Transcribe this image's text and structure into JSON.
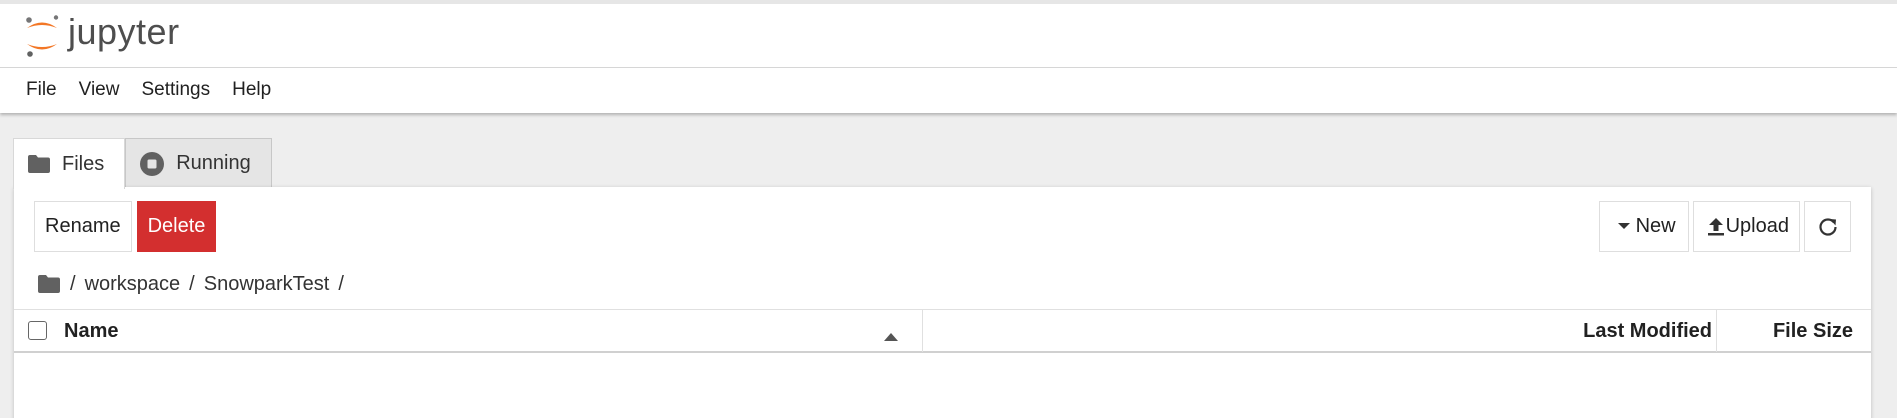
{
  "app": {
    "brand": "jupyter",
    "logo_icon": "jupyter-logo-icon",
    "accent_color": "#f37726"
  },
  "menu": {
    "items": [
      "File",
      "View",
      "Settings",
      "Help"
    ]
  },
  "tabs": [
    {
      "label": "Files",
      "icon": "folder-icon",
      "active": true
    },
    {
      "label": "Running",
      "icon": "stop-circle-icon",
      "active": false
    }
  ],
  "toolbar": {
    "rename_label": "Rename",
    "delete_label": "Delete",
    "delete_color": "#d32f2f",
    "new_label": "New",
    "new_icon": "caret-down-icon",
    "upload_label": "Upload",
    "upload_icon": "upload-icon",
    "refresh_icon": "refresh-icon"
  },
  "breadcrumb": {
    "root_icon": "folder-icon",
    "path": [
      "workspace",
      "SnowparkTest"
    ],
    "separator": "/"
  },
  "file_list": {
    "columns": {
      "name": "Name",
      "last_modified": "Last Modified",
      "file_size": "File Size"
    },
    "sort": {
      "column": "Name",
      "direction": "ascending"
    },
    "rows": []
  }
}
